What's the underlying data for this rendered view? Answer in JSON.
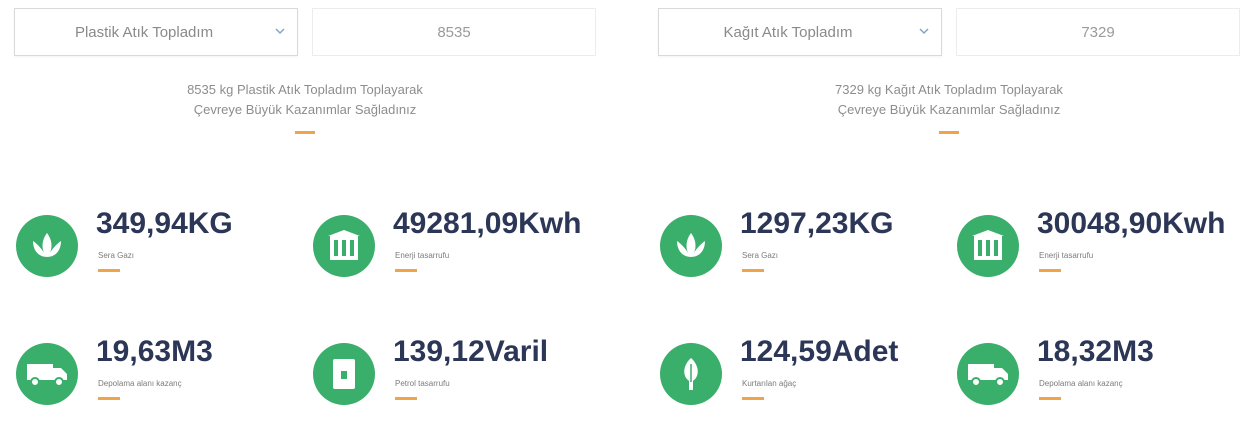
{
  "panels": [
    {
      "select_label": "Plastik Atık Topladım",
      "amount": "8535",
      "message_line1": "8535 kg Plastik Atık Topladım Toplayarak",
      "message_line2": "Çevreye Büyük Kazanımlar Sağladınız",
      "stats": [
        {
          "value": "349,94KG",
          "label": "Sera Gazı",
          "icon": "lotus-icon"
        },
        {
          "value": "49281,09Kwh",
          "label": "Enerji tasarrufu",
          "icon": "building-icon"
        },
        {
          "value": "19,63M3",
          "label": "Depolama alanı kazanç",
          "icon": "truck-icon"
        },
        {
          "value": "139,12Varil",
          "label": "Petrol tasarrufu",
          "icon": "oil-barrel-icon"
        }
      ]
    },
    {
      "select_label": "Kağıt Atık Topladım",
      "amount": "7329",
      "message_line1": "7329 kg Kağıt Atık Topladım Toplayarak",
      "message_line2": "Çevreye Büyük Kazanımlar Sağladınız",
      "stats": [
        {
          "value": "1297,23KG",
          "label": "Sera Gazı",
          "icon": "lotus-icon"
        },
        {
          "value": "30048,90Kwh",
          "label": "Enerji tasarrufu",
          "icon": "building-icon"
        },
        {
          "value": "124,59Adet",
          "label": "Kurtarılan ağaç",
          "icon": "tree-icon"
        },
        {
          "value": "18,32M3",
          "label": "Depolama alanı kazanç",
          "icon": "truck-icon"
        }
      ]
    }
  ],
  "colors": {
    "icon_green": "#3aae6b",
    "accent_orange": "#f0a447",
    "value_navy": "#2c3656"
  }
}
